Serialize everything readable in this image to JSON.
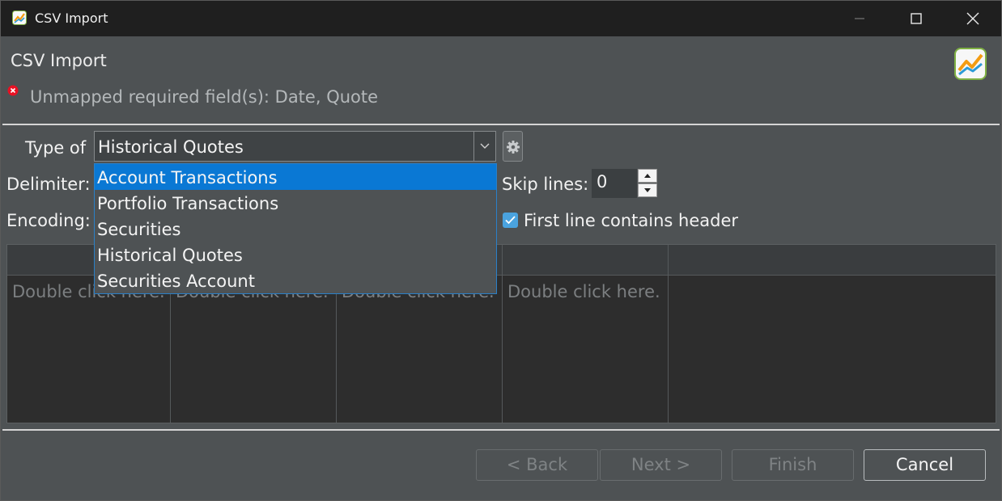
{
  "window": {
    "title": "CSV Import",
    "controls": {
      "minimize": "minimize-icon",
      "maximize": "maximize-icon",
      "close": "close-icon"
    }
  },
  "header": {
    "title": "CSV Import",
    "error_message": "Unmapped required field(s): Date, Quote",
    "error_icon": "error-icon",
    "logo_icon": "chart-logo-icon"
  },
  "form": {
    "type_label": "Type of",
    "type_selected": "Historical Quotes",
    "type_options": [
      "Account Transactions",
      "Portfolio Transactions",
      "Securities",
      "Historical Quotes",
      "Securities Account"
    ],
    "highlighted_option": "Account Transactions",
    "delimiter_label": "Delimiter:",
    "encoding_label": "Encoding:",
    "skip_lines_label": "Skip lines:",
    "skip_lines_value": "0",
    "first_line_header_label": "First line contains header",
    "first_line_header_checked": true
  },
  "table": {
    "columns": [
      {
        "header": "",
        "hint": "Double click here."
      },
      {
        "header": "",
        "hint": "Double click here."
      },
      {
        "header": "",
        "hint": "Double click here."
      },
      {
        "header": "",
        "hint": "Double click here."
      },
      {
        "header": "",
        "hint": ""
      }
    ]
  },
  "buttons": {
    "back": "< Back",
    "next": "Next >",
    "finish": "Finish",
    "cancel": "Cancel"
  },
  "colors": {
    "accent": "#0a78d4",
    "error": "#e81123",
    "checkbox": "#4aa3df"
  }
}
